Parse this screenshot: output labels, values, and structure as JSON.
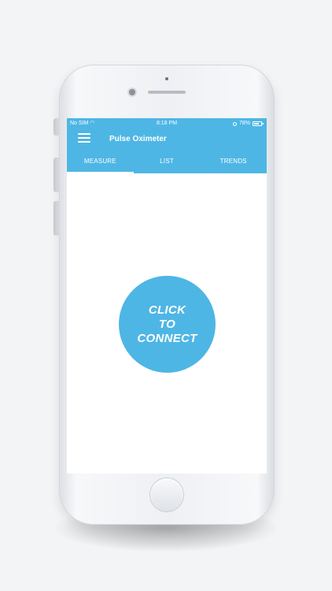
{
  "status_bar": {
    "carrier": "No SIM",
    "wifi_icon": "wifi-icon",
    "time": "8:18 PM",
    "battery_percent": "78%",
    "battery_level": 0.78
  },
  "app_bar": {
    "title": "Pulse Oximeter",
    "menu_icon": "hamburger-menu-icon",
    "background_color": "#4eb6e5"
  },
  "tabs": [
    {
      "label": "MEASURE",
      "active": true
    },
    {
      "label": "LIST",
      "active": false
    },
    {
      "label": "TRENDS",
      "active": false
    }
  ],
  "connect_button": {
    "lines": [
      "CLICK",
      "TO",
      "CONNECT"
    ],
    "color": "#4eb6e5"
  }
}
